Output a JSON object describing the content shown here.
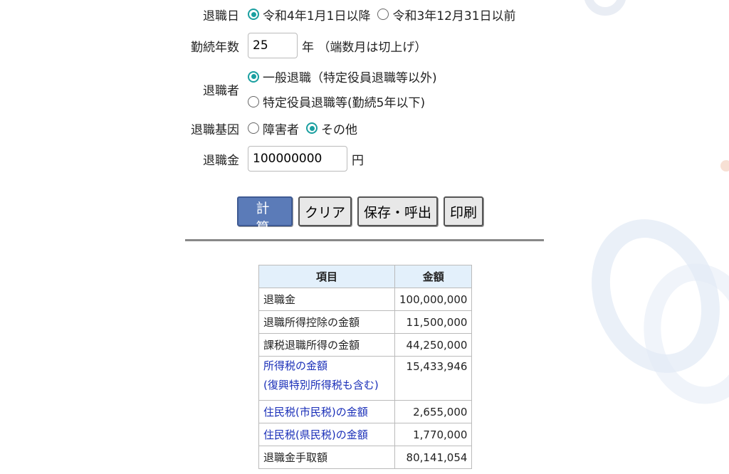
{
  "form": {
    "retirement_date": {
      "label": "退職日",
      "options": [
        {
          "label": "令和4年1月1日以降",
          "checked": true
        },
        {
          "label": "令和3年12月31日以前",
          "checked": false
        }
      ]
    },
    "years": {
      "label": "勤続年数",
      "value": "25",
      "unit": "年 （端数月は切上げ）"
    },
    "retiree": {
      "label": "退職者",
      "options": [
        {
          "label": "一般退職（特定役員退職等以外)",
          "checked": true
        },
        {
          "label": "特定役員退職等(勤続5年以下)",
          "checked": false
        }
      ]
    },
    "cause": {
      "label": "退職基因",
      "options": [
        {
          "label": "障害者",
          "checked": false
        },
        {
          "label": "その他",
          "checked": true
        }
      ]
    },
    "amount": {
      "label": "退職金",
      "value": "100000000",
      "unit": "円"
    }
  },
  "buttons": {
    "calculate": "計 算",
    "clear": "クリア",
    "save_load": "保存・呼出",
    "print": "印刷"
  },
  "table": {
    "headers": {
      "item": "項目",
      "amount": "金額"
    },
    "rows": [
      {
        "item": "退職金",
        "amount": "100,000,000"
      },
      {
        "item": "退職所得控除の金額",
        "amount": "11,500,000"
      },
      {
        "item": "課税退職所得の金額",
        "amount": "44,250,000"
      },
      {
        "item_line1": "所得税の金額",
        "item_line2": "(復興特別所得税も含む)",
        "amount": "15,433,946"
      },
      {
        "item": "住民税(市民税)の金額",
        "amount": "2,655,000"
      },
      {
        "item": "住民税(県民税)の金額",
        "amount": "1,770,000"
      },
      {
        "item": "退職金手取額",
        "amount": "80,141,054"
      }
    ]
  },
  "colors": {
    "radio_checked": "#1a9fa0",
    "primary_button": "#5b7bb8",
    "link_text": "#1a2fb8",
    "table_header_bg": "#e3f0fb"
  }
}
